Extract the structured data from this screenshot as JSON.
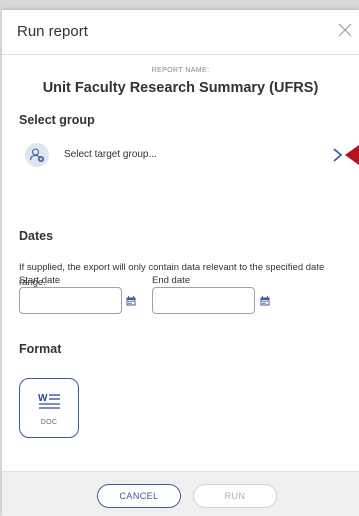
{
  "modal": {
    "title": "Run report",
    "report_name_label": "REPORT NAME:",
    "report_name": "Unit Faculty Research Summary (UFRS)"
  },
  "select_group": {
    "heading": "Select group",
    "placeholder": "Select target group...",
    "icon": "user-group-icon"
  },
  "dates": {
    "heading": "Dates",
    "help": "If supplied, the export will only contain data relevant to the specified date range.",
    "start_label": "Start date",
    "start_value": "",
    "end_label": "End date",
    "end_value": ""
  },
  "format": {
    "heading": "Format",
    "options": [
      {
        "label": "DOC",
        "icon": "word-document-icon"
      }
    ]
  },
  "footer": {
    "cancel_label": "CANCEL",
    "run_label": "RUN"
  },
  "colors": {
    "accent": "#3d5a99",
    "marker": "#b5121b",
    "disabled": "#b0b0b0"
  }
}
